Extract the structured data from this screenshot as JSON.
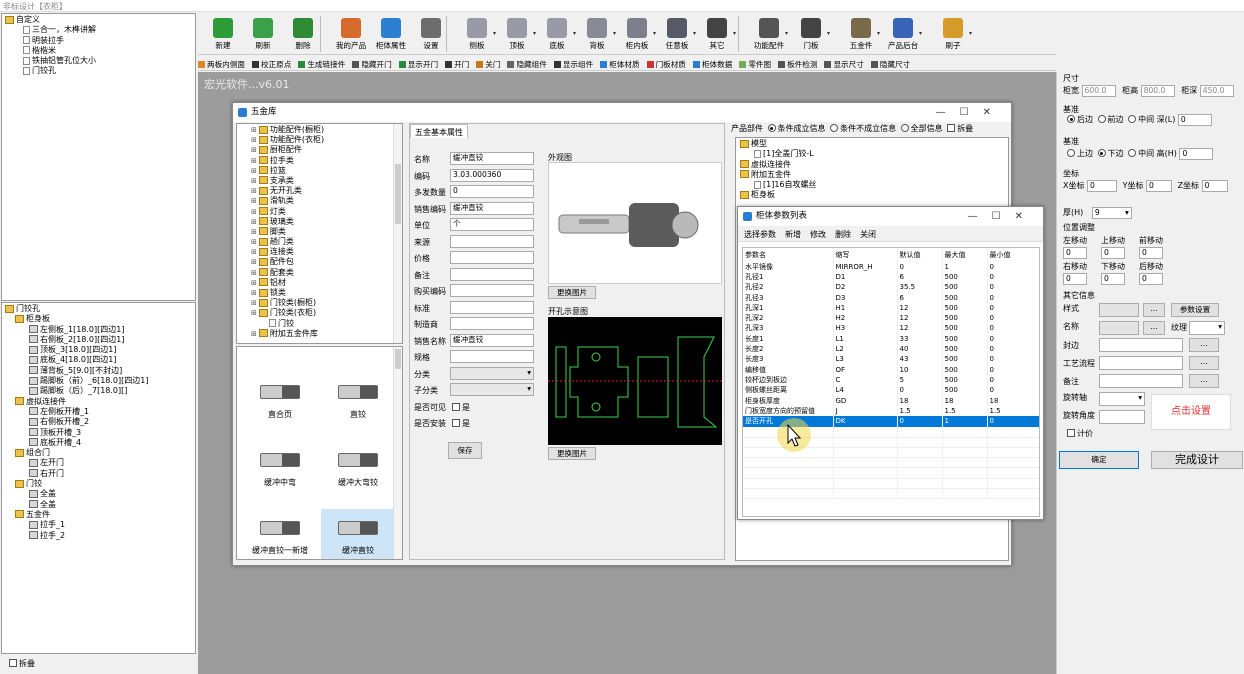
{
  "app": {
    "title": "非标设计【衣柜】",
    "watermark": "宏光软件...v6.01"
  },
  "tree_top": {
    "root": "自定义",
    "items": [
      "三合一，木榫讲解",
      "明装拉手",
      "楷楷米",
      "铁抽铝管孔位大小",
      "门铰孔"
    ]
  },
  "tree_bottom": {
    "root": "门铰孔",
    "groups": [
      {
        "name": "柜身板",
        "items": [
          "左侧板_1[18.0][四边1]",
          "右侧板_2[18.0][四边1]",
          "顶板_3[18.0][四边1]",
          "底板_4[18.0][四边1]",
          "薄背板_5[9.0][不封边]",
          "踢脚板（前）_6[18.0][四边1]",
          "踢脚板（后）_7[18.0][]"
        ]
      },
      {
        "name": "虚拟连接件",
        "items": [
          "左侧板开槽_1",
          "右侧板开槽_2",
          "顶板开槽_3",
          "底板开槽_4"
        ]
      },
      {
        "name": "组合门",
        "items": [
          "左开门",
          "右开门"
        ]
      },
      {
        "name": "门铰",
        "items": [
          "全盖",
          "全盖"
        ]
      },
      {
        "name": "五金件",
        "items": [
          "拉手_1",
          "拉手_2"
        ]
      }
    ],
    "fold_label": "拆叠"
  },
  "toolbar": [
    {
      "label": "新建",
      "color": "#2e9d39"
    },
    {
      "label": "刷新",
      "color": "#3aa14a"
    },
    {
      "label": "删除",
      "color": "#2f8a34"
    },
    {
      "label": "我的产品",
      "color": "#d46a2c"
    },
    {
      "label": "柜体属性",
      "color": "#2d7fd1"
    },
    {
      "label": "设置",
      "color": "#6d6d6d"
    },
    {
      "label": "侧板",
      "color": "#9a9aa6"
    },
    {
      "label": "顶板",
      "color": "#9a9aa6"
    },
    {
      "label": "底板",
      "color": "#9a9aa6"
    },
    {
      "label": "背板",
      "color": "#8a8a96"
    },
    {
      "label": "柜内板",
      "color": "#7e7e8c"
    },
    {
      "label": "任意板",
      "color": "#555a66"
    },
    {
      "label": "其它",
      "color": "#444"
    },
    {
      "label": "功能配件",
      "color": "#555"
    },
    {
      "label": "门板",
      "color": "#444"
    },
    {
      "label": "五金件",
      "color": "#7a6a4a"
    },
    {
      "label": "产品后台",
      "color": "#3a64b8"
    },
    {
      "label": "刷子",
      "color": "#d59a2a"
    }
  ],
  "toolbar2": [
    "两板内侧面",
    "校正原点",
    "生成链接件",
    "隐藏开门",
    "显示开门",
    "开门",
    "关门",
    "隐藏组件",
    "显示组件",
    "柜体材质",
    "门板材质",
    "柜体数据",
    "零件图",
    "板件检测",
    "显示尺寸",
    "隐藏尺寸"
  ],
  "hardware_window": {
    "title": "五金库",
    "categories": [
      "功能配件(橱柜)",
      "功能配件(衣柜)",
      "厨柜配件",
      "拉手类",
      "拉篮",
      "支承类",
      "无开孔类",
      "滑轨类",
      "灯类",
      "玻璃类",
      "脚类",
      "趟门类",
      "连接类",
      "配件包",
      "配套类",
      "铝材",
      "锁类",
      "门铰类(橱柜)",
      "门铰类(衣柜)",
      "门铰",
      "附加五金件库"
    ],
    "thumbs": [
      "直合页",
      "直铰",
      "缓冲中弯",
      "缓冲大弯铰",
      "缓冲直铰一新增",
      "缓冲直铰"
    ],
    "props_title": "五金基本属性",
    "props": [
      {
        "label": "名称",
        "value": "缓冲直铰"
      },
      {
        "label": "编码",
        "value": "3.03.000360"
      },
      {
        "label": "多发数量",
        "value": "0"
      },
      {
        "label": "销售编码",
        "value": "缓冲直铰"
      },
      {
        "label": "单位",
        "value": "个"
      },
      {
        "label": "来源",
        "value": ""
      },
      {
        "label": "价格",
        "value": ""
      },
      {
        "label": "备注",
        "value": ""
      },
      {
        "label": "购买编码",
        "value": ""
      },
      {
        "label": "标准",
        "value": ""
      },
      {
        "label": "制造商",
        "value": ""
      },
      {
        "label": "销售名称",
        "value": "缓冲直铰"
      },
      {
        "label": "规格",
        "value": ""
      },
      {
        "label": "分类",
        "value": ""
      },
      {
        "label": "子分类",
        "value": ""
      }
    ],
    "visible_label": "是否可见",
    "install_label": "是否安装",
    "yes": "是",
    "save": "保存",
    "appearance": "外观图",
    "drill": "开孔示意图",
    "change_img": "更换图片",
    "product_parts": "产品部件",
    "opt_true": "条件成立信息",
    "opt_false": "条件不成立信息",
    "opt_all": "全部信息",
    "fold": "拆叠",
    "parts_tree": [
      "模型",
      "[1]全盖门铰-L",
      "虚拟连接件",
      "附加五金件",
      "[1]16自攻螺丝",
      "柜身板"
    ]
  },
  "param_window": {
    "title": "柜体参数列表",
    "menu": [
      "选择参数",
      "新增",
      "修改",
      "删除",
      "关闭"
    ],
    "headers": [
      "参数名",
      "缩写",
      "默认值",
      "最大值",
      "最小值"
    ],
    "rows": [
      [
        "水平镜像",
        "MIRROR_H",
        "0",
        "1",
        "0"
      ],
      [
        "孔径1",
        "D1",
        "6",
        "500",
        "0"
      ],
      [
        "孔径2",
        "D2",
        "35.5",
        "500",
        "0"
      ],
      [
        "孔径3",
        "D3",
        "6",
        "500",
        "0"
      ],
      [
        "孔深1",
        "H1",
        "12",
        "500",
        "0"
      ],
      [
        "孔深2",
        "H2",
        "12",
        "500",
        "0"
      ],
      [
        "孔深3",
        "H3",
        "12",
        "500",
        "0"
      ],
      [
        "长度1",
        "L1",
        "33",
        "500",
        "0"
      ],
      [
        "长度2",
        "L2",
        "40",
        "500",
        "0"
      ],
      [
        "长度3",
        "L3",
        "43",
        "500",
        "0"
      ],
      [
        "编移值",
        "OF",
        "10",
        "500",
        "0"
      ],
      [
        "铰杯边到板边",
        "C",
        "5",
        "500",
        "0"
      ],
      [
        "侧板螺丝距离",
        "L4",
        "0",
        "500",
        "0"
      ],
      [
        "柜身板厚度",
        "GD",
        "18",
        "18",
        "18"
      ],
      [
        "门板宽度方向的预留值",
        "J",
        "1.5",
        "1.5",
        "1.5"
      ],
      [
        "是否开孔",
        "DK",
        "0",
        "1",
        "0"
      ]
    ],
    "selected_row": 15
  },
  "right": {
    "size": "尺寸",
    "w_lbl": "柜宽",
    "w": "600.0",
    "d_lbl": "柜高",
    "d": "800.0",
    "h_lbl": "柜深",
    "h": "450.0",
    "base1": "基准",
    "b1": [
      "后边",
      "前边",
      "中间",
      "深(L)"
    ],
    "b1v": "0",
    "base2": "基准",
    "b2": [
      "上边",
      "下边",
      "中间",
      "高(H)"
    ],
    "b2v": "0",
    "coord": "坐标",
    "x": "X坐标",
    "xv": "0",
    "y": "Y坐标",
    "yv": "0",
    "z": "Z坐标",
    "zv": "0",
    "thick": "厚(H)",
    "thickv": "9",
    "pos": "位置调整",
    "moves": [
      "左移动",
      "上移动",
      "前移动",
      "右移动",
      "下移动",
      "后移动"
    ],
    "movev": "0",
    "other": "其它信息",
    "style": "样式",
    "param_btn": "参数设置",
    "name": "名称",
    "texture": "纹理",
    "edge": "封边",
    "process": "工艺流程",
    "note": "备注",
    "rot_axis": "旋转轴",
    "rot_angle": "旋转角度",
    "price": "计价",
    "click": "点击设置",
    "ok": "确定",
    "finish": "完成设计",
    "dots": "..."
  }
}
